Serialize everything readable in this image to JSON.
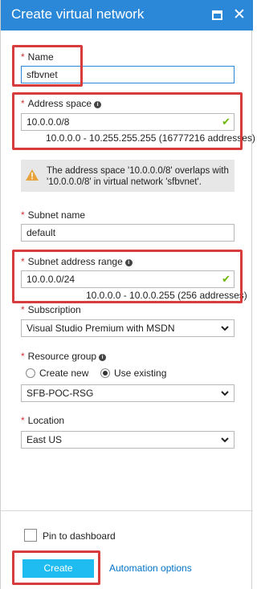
{
  "header": {
    "title": "Create virtual network"
  },
  "name": {
    "label": "Name",
    "value": "sfbvnet"
  },
  "address_space": {
    "label": "Address space",
    "value": "10.0.0.0/8",
    "range_hint": "10.0.0.0 - 10.255.255.255 (16777216 addresses)"
  },
  "warning": {
    "text": "The address space '10.0.0.0/8' overlaps with '10.0.0.0/8' in virtual network 'sfbvnet'."
  },
  "subnet_name": {
    "label": "Subnet name",
    "value": "default"
  },
  "subnet_range": {
    "label": "Subnet address range",
    "value": "10.0.0.0/24",
    "range_hint": "10.0.0.0 - 10.0.0.255 (256 addresses)"
  },
  "subscription": {
    "label": "Subscription",
    "value": "Visual Studio Premium with MSDN"
  },
  "resource_group": {
    "label": "Resource group",
    "option_new": "Create new",
    "option_existing": "Use existing",
    "selected_option": "existing",
    "value": "SFB-POC-RSG"
  },
  "location": {
    "label": "Location",
    "value": "East US"
  },
  "footer": {
    "pin_label": "Pin to dashboard",
    "pin_checked": false,
    "create_label": "Create",
    "automation_label": "Automation options"
  },
  "colors": {
    "header": "#2b88d8",
    "required": "#d13438",
    "highlight": "#d83b3b",
    "create_button": "#1ebcf0",
    "link": "#0072c6",
    "valid_check": "#6bb700"
  }
}
